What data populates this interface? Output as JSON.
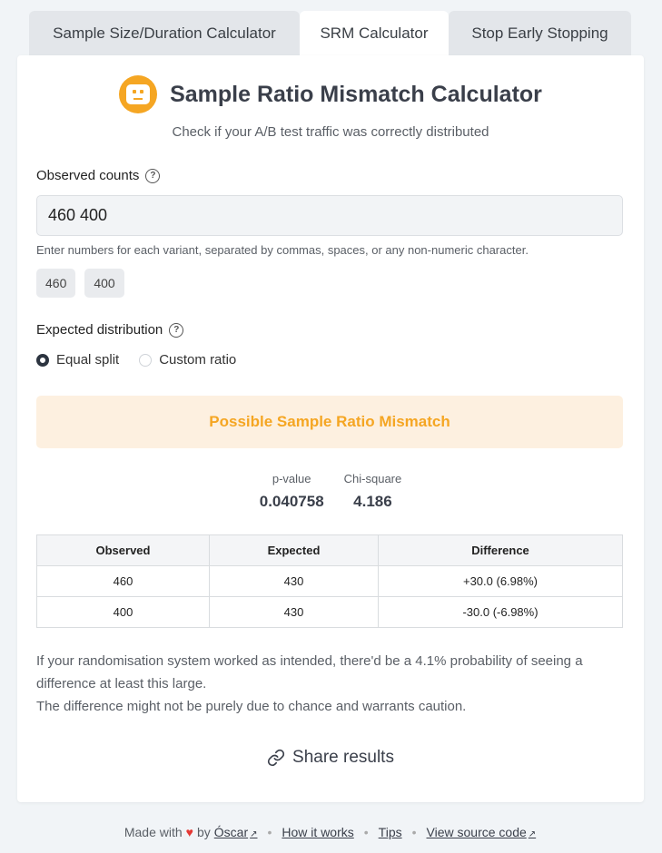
{
  "tabs": [
    "Sample Size/Duration Calculator",
    "SRM Calculator",
    "Stop Early Stopping"
  ],
  "header": {
    "title": "Sample Ratio Mismatch Calculator",
    "subtitle": "Check if your A/B test traffic was correctly distributed"
  },
  "observed": {
    "label": "Observed counts",
    "value": "460 400",
    "hint": "Enter numbers for each variant, separated by commas, spaces, or any non-numeric character.",
    "chips": [
      "460",
      "400"
    ]
  },
  "expected": {
    "label": "Expected distribution",
    "options": [
      "Equal split",
      "Custom ratio"
    ],
    "selected": "Equal split"
  },
  "alert": "Possible Sample Ratio Mismatch",
  "stats": {
    "pvalue_label": "p-value",
    "pvalue": "0.040758",
    "chisq_label": "Chi-square",
    "chisq": "4.186"
  },
  "table": {
    "headers": [
      "Observed",
      "Expected",
      "Difference"
    ],
    "rows": [
      [
        "460",
        "430",
        "+30.0 (6.98%)"
      ],
      [
        "400",
        "430",
        "-30.0 (-6.98%)"
      ]
    ]
  },
  "explanation": {
    "line1": "If your randomisation system worked as intended, there'd be a 4.1% probability of seeing a difference at least this large.",
    "line2": "The difference might not be purely due to chance and warrants caution."
  },
  "share_label": "Share results",
  "footer": {
    "made_with": "Made with",
    "by": "by",
    "author": "Óscar",
    "links": [
      "How it works",
      "Tips",
      "View source code"
    ]
  }
}
